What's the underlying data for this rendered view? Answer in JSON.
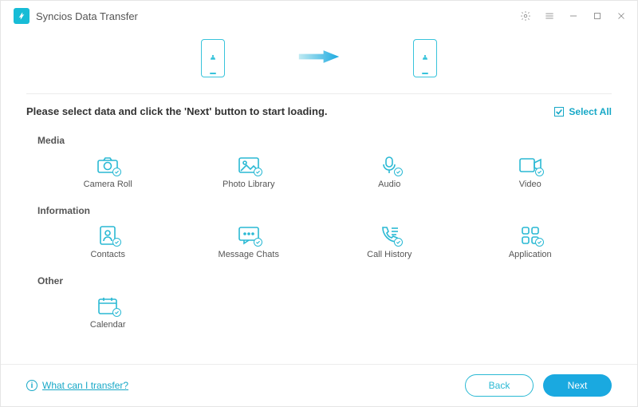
{
  "app": {
    "title": "Syncios Data Transfer"
  },
  "instruction": "Please select data and click the 'Next' button to start loading.",
  "selectAll": {
    "label": "Select All",
    "checked": true
  },
  "sections": {
    "media": {
      "label": "Media",
      "items": {
        "cameraRoll": "Camera Roll",
        "photoLibrary": "Photo Library",
        "audio": "Audio",
        "video": "Video"
      }
    },
    "information": {
      "label": "Information",
      "items": {
        "contacts": "Contacts",
        "messageChats": "Message Chats",
        "callHistory": "Call History",
        "application": "Application"
      }
    },
    "other": {
      "label": "Other",
      "items": {
        "calendar": "Calendar"
      }
    }
  },
  "footer": {
    "helpLink": "What can I transfer?",
    "back": "Back",
    "next": "Next"
  }
}
